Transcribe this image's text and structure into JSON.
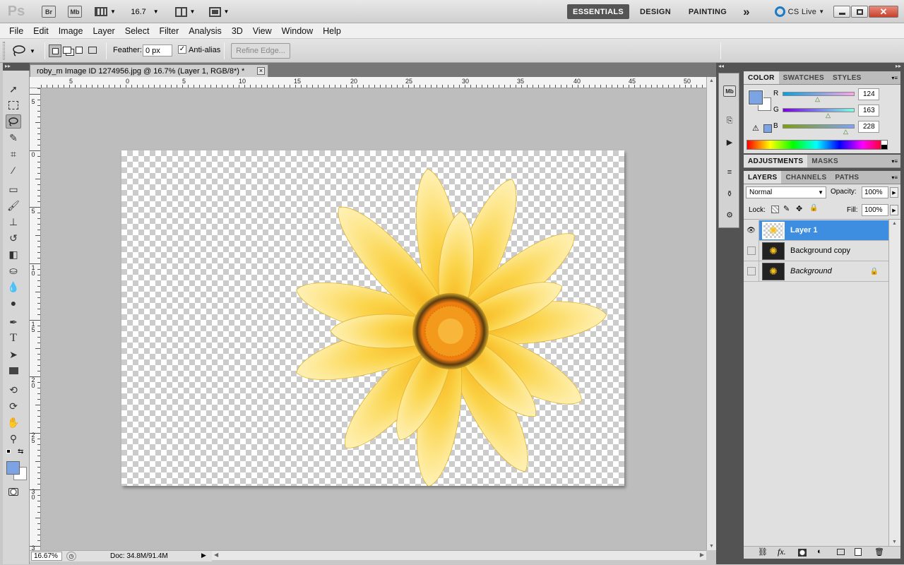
{
  "appbar": {
    "logo": "Ps",
    "bridge_label": "Br",
    "minibridge_label": "Mb",
    "zoom_value": "16.7",
    "workspaces": [
      "ESSENTIALS",
      "DESIGN",
      "PAINTING"
    ],
    "active_workspace": "ESSENTIALS",
    "more_label": "»",
    "cslive_label": "CS Live"
  },
  "menu": [
    "File",
    "Edit",
    "Image",
    "Layer",
    "Select",
    "Filter",
    "Analysis",
    "3D",
    "View",
    "Window",
    "Help"
  ],
  "options": {
    "feather_label": "Feather:",
    "feather_value": "0 px",
    "antialias_label": "Anti-alias",
    "antialias_checked": true,
    "refine_edge_label": "Refine Edge..."
  },
  "document": {
    "tab_title": "roby_m Image ID  1274956.jpg @ 16.7% (Layer 1, RGB/8*) *",
    "close_label": "×"
  },
  "rulers": {
    "h_labels": [
      "5",
      "0",
      "5",
      "10",
      "15",
      "20",
      "25",
      "30",
      "35",
      "40",
      "45",
      "50"
    ],
    "v_labels": [
      "5",
      "0",
      "5",
      "1\n0",
      "1\n5",
      "2\n0",
      "2\n5",
      "3\n0",
      "3"
    ]
  },
  "status": {
    "zoom": "16.67%",
    "doc_info": "Doc: 34.8M/91.4M"
  },
  "color_panel": {
    "tabs": [
      "COLOR",
      "SWATCHES",
      "STYLES"
    ],
    "active_tab": "COLOR",
    "foreground": "#7ca3e4",
    "background": "#ffffff",
    "channels": [
      {
        "label": "R",
        "value": "124"
      },
      {
        "label": "G",
        "value": "163"
      },
      {
        "label": "B",
        "value": "228"
      }
    ]
  },
  "adjustments_panel": {
    "tabs": [
      "ADJUSTMENTS",
      "MASKS"
    ]
  },
  "layers_panel": {
    "tabs": [
      "LAYERS",
      "CHANNELS",
      "PATHS"
    ],
    "blend_mode": "Normal",
    "opacity_label": "Opacity:",
    "opacity_value": "100%",
    "lock_label": "Lock:",
    "fill_label": "Fill:",
    "fill_value": "100%",
    "layers": [
      {
        "name": "Layer 1",
        "selected": true,
        "visible": true
      },
      {
        "name": "Background copy",
        "selected": false,
        "visible": false
      },
      {
        "name": "Background",
        "selected": false,
        "visible": false,
        "locked": true
      }
    ]
  },
  "colors": {
    "accent": "#3d8ee0",
    "panel_dark": "#535353",
    "flower_petal": "#fde36a",
    "flower_center": "#f08a10"
  }
}
